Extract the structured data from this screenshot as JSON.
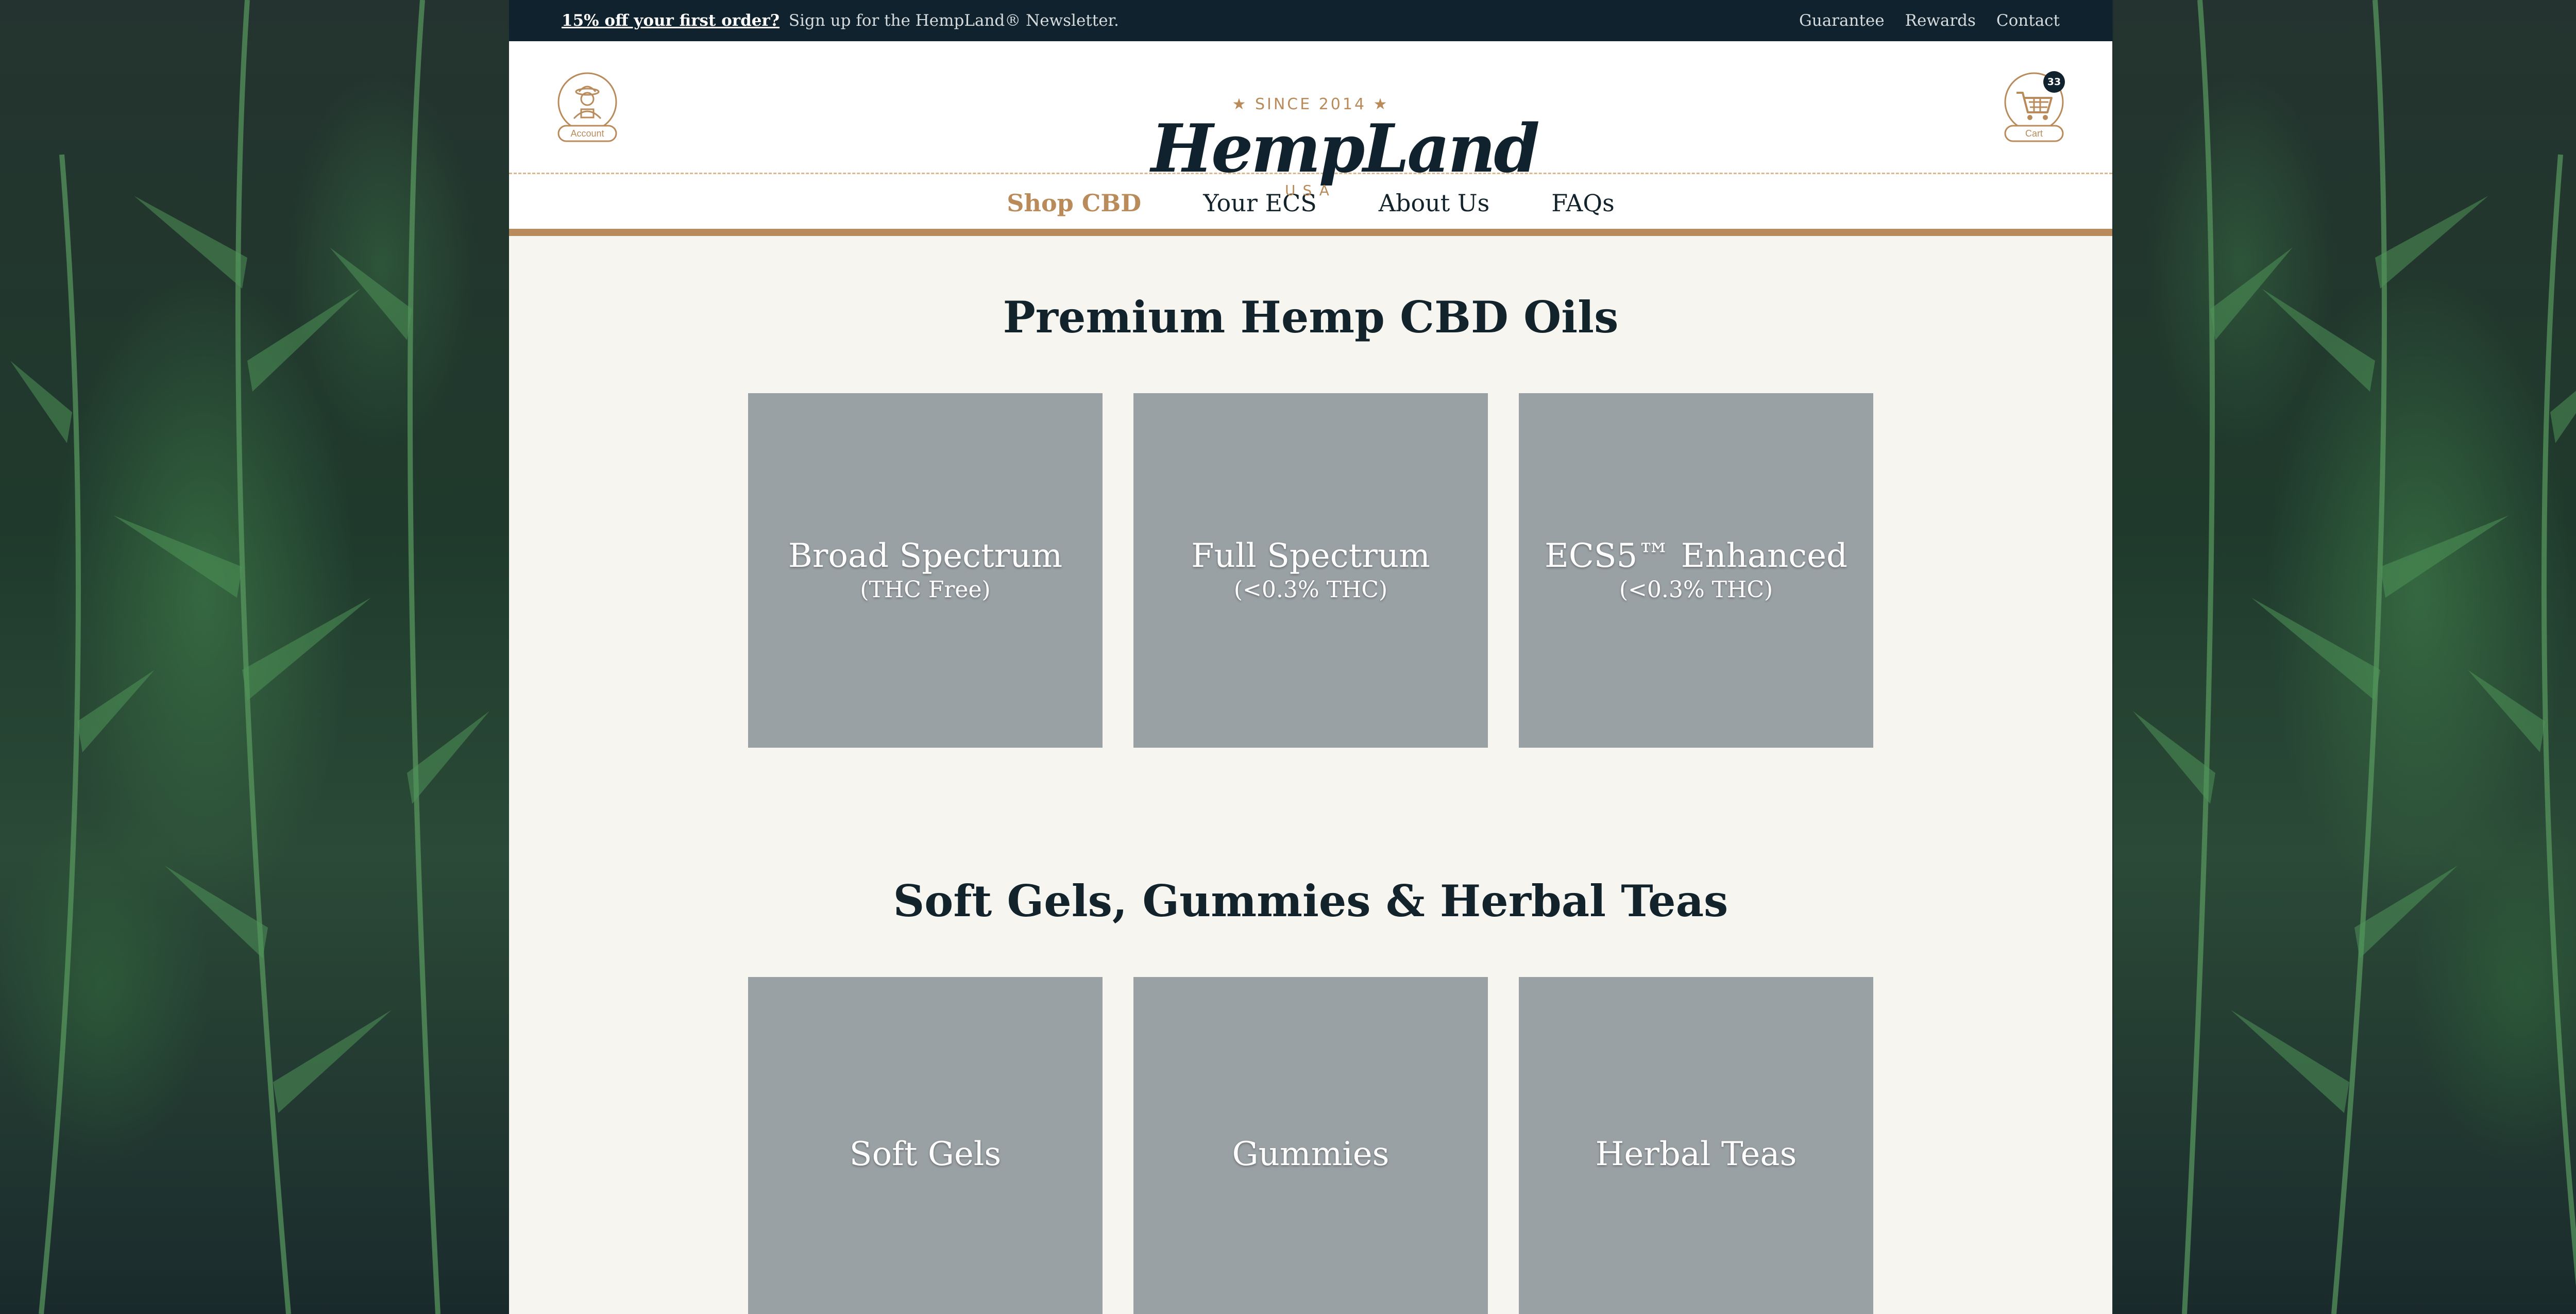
{
  "topbar": {
    "promo_link": "15% off your first order?",
    "promo_text": "Sign up for the HempLand® Newsletter.",
    "links": [
      "Guarantee",
      "Rewards",
      "Contact"
    ]
  },
  "header": {
    "account_label": "Account",
    "cart_label": "Cart",
    "cart_count": "33",
    "logo": {
      "since": "★ SINCE 2014 ★",
      "name": "HempLand",
      "sub": "USA"
    }
  },
  "nav": {
    "items": [
      {
        "label": "Shop CBD",
        "active": true
      },
      {
        "label": "Your ECS"
      },
      {
        "label": "About Us"
      },
      {
        "label": "FAQs"
      }
    ]
  },
  "sections": [
    {
      "title": "Premium Hemp CBD Oils",
      "tiles": [
        {
          "title": "Broad Spectrum",
          "subtitle": "(THC Free)"
        },
        {
          "title": "Full Spectrum",
          "subtitle": "(<0.3% THC)"
        },
        {
          "title": "ECS5™ Enhanced",
          "subtitle": "(<0.3% THC)"
        }
      ]
    },
    {
      "title": "Soft Gels, Gummies & Herbal Teas",
      "tiles": [
        {
          "title": "Soft Gels"
        },
        {
          "title": "Gummies"
        },
        {
          "title": "Herbal Teas"
        }
      ]
    }
  ],
  "colors": {
    "brand_navy": "#0f222d",
    "brand_copper": "#b98a5a",
    "tile_gray": "#9aa1a5",
    "page_bg": "#f7f5f0"
  }
}
